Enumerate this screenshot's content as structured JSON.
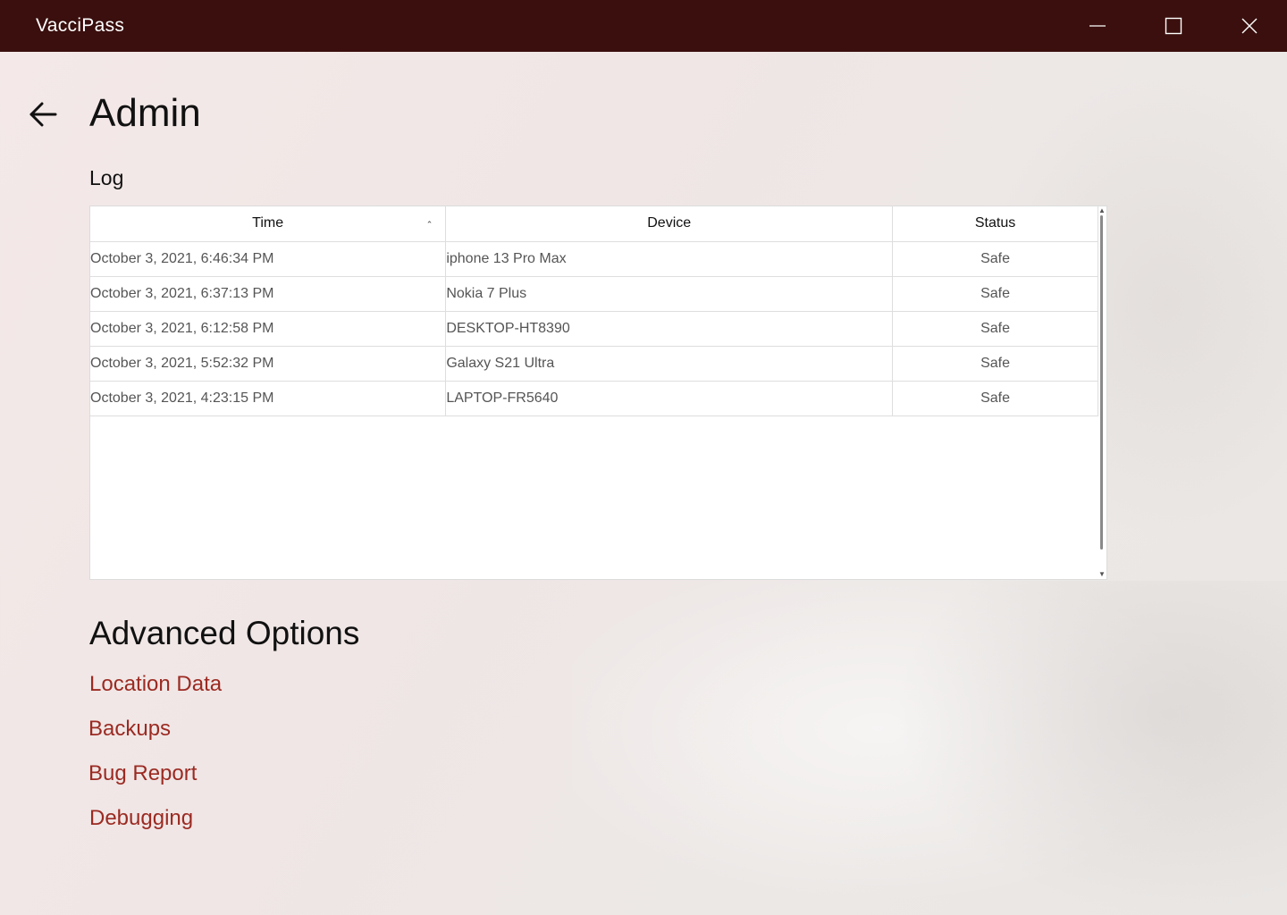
{
  "window": {
    "title": "VacciPass",
    "controls": [
      "minimize",
      "maximize",
      "close"
    ]
  },
  "page": {
    "title": "Admin",
    "back_icon": "arrow-left-icon"
  },
  "log": {
    "heading": "Log",
    "columns": [
      "Time",
      "Device",
      "Status"
    ],
    "sort": {
      "column": "Time",
      "direction": "ascending"
    },
    "rows": [
      {
        "time": "October 3, 2021, 6:46:34 PM",
        "device": "iphone 13 Pro Max",
        "status": "Safe"
      },
      {
        "time": "October 3, 2021, 6:37:13 PM",
        "device": "Nokia 7 Plus",
        "status": "Safe"
      },
      {
        "time": "October 3, 2021, 6:12:58 PM",
        "device": "DESKTOP-HT8390",
        "status": "Safe"
      },
      {
        "time": "October 3, 2021, 5:52:32 PM",
        "device": "Galaxy S21 Ultra",
        "status": "Safe"
      },
      {
        "time": "October 3, 2021, 4:23:15 PM",
        "device": "LAPTOP-FR5640",
        "status": "Safe"
      }
    ]
  },
  "advanced": {
    "heading": "Advanced Options",
    "links": [
      "Location Data",
      "Backups",
      "Bug Report",
      "Debugging"
    ]
  },
  "colors": {
    "titlebar": "#3a0f0d",
    "link": "#9b2a22"
  }
}
